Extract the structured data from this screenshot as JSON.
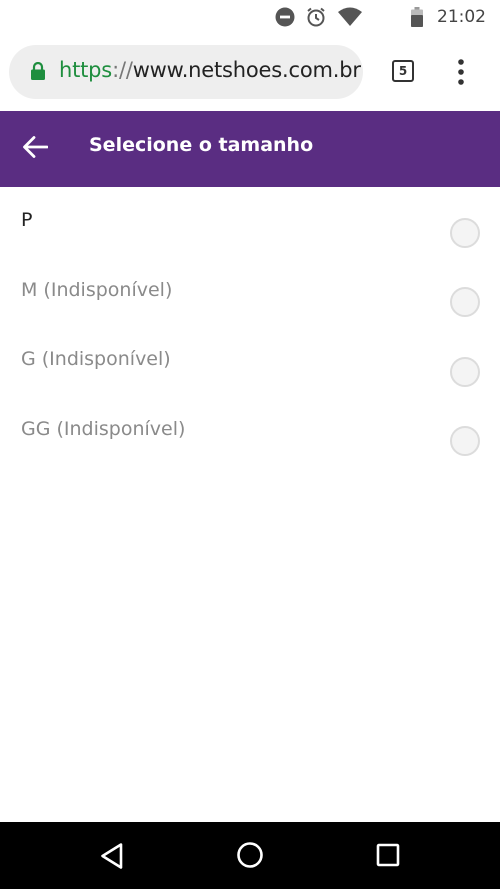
{
  "status_bar": {
    "time": "21:02",
    "icons": [
      "do-not-disturb-icon",
      "alarm-icon",
      "wifi-icon",
      "battery-icon"
    ]
  },
  "browser": {
    "url_scheme": "https",
    "url_separator": "://",
    "url_host": "www.netshoes.com.br",
    "tab_count": "5",
    "scheme_color": "#1e8e3e"
  },
  "header": {
    "title": "Selecione o tamanho",
    "background_color": "#5a2d82"
  },
  "sizes": [
    {
      "label": "P",
      "available": true,
      "selected": false
    },
    {
      "label": "M (Indisponível)",
      "available": false,
      "selected": false
    },
    {
      "label": "G (Indisponível)",
      "available": false,
      "selected": false
    },
    {
      "label": "GG (Indisponível)",
      "available": false,
      "selected": false
    }
  ],
  "colors": {
    "available_text": "#222222",
    "unavailable_text": "#8a8a8a"
  },
  "nav_bar": {
    "buttons": [
      "back-triangle-icon",
      "home-circle-icon",
      "recents-square-icon"
    ]
  }
}
